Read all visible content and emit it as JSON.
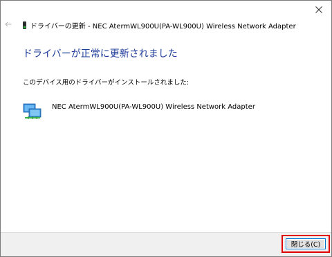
{
  "window": {
    "title": "ドライバーの更新 - NEC AtermWL900U(PA-WL900U) Wireless Network Adapter"
  },
  "main": {
    "heading": "ドライバーが正常に更新されました",
    "subtext": "このデバイス用のドライバーがインストールされました:",
    "device_name": "NEC AtermWL900U(PA-WL900U) Wireless Network Adapter"
  },
  "footer": {
    "close_button_label": "閉じる(C)"
  },
  "icons": {
    "close": "close-icon",
    "back": "back-arrow-icon",
    "device": "usb-device-icon",
    "network_adapter": "network-adapter-icon"
  },
  "colors": {
    "heading": "#1e3c9a",
    "highlight": "#e00000",
    "button_border": "#0078d7"
  }
}
